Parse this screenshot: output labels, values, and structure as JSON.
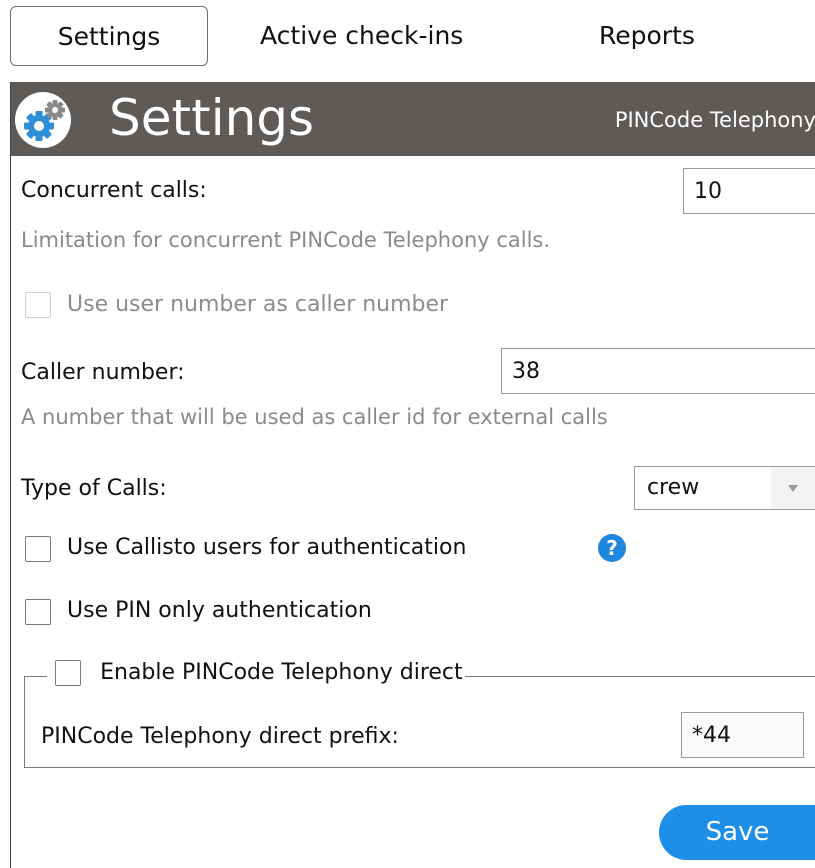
{
  "tabs": [
    {
      "label": "Settings",
      "active": true
    },
    {
      "label": "Active check-ins",
      "active": false
    },
    {
      "label": "Reports",
      "active": false
    }
  ],
  "header": {
    "title": "Settings",
    "subtitle": "PINCode Telephony",
    "logo_icon": "gears-icon",
    "background": "#5d5a58"
  },
  "form": {
    "concurrent_calls": {
      "label": "Concurrent calls:",
      "value": "10",
      "hint": "Limitation for concurrent PINCode Telephony calls."
    },
    "use_user_number": {
      "label": "Use user number as caller number",
      "checked": false,
      "disabled": true
    },
    "caller_number": {
      "label": "Caller number:",
      "value": "38",
      "hint": "A number that will be used as caller id for external calls"
    },
    "type_of_calls": {
      "label": "Type of Calls:",
      "selected": "crew"
    },
    "use_callisto_users": {
      "label": "Use Callisto users for authentication",
      "checked": false,
      "help_icon": "?"
    },
    "use_pin_only": {
      "label": "Use PIN only authentication",
      "checked": false
    },
    "direct": {
      "legend_label": "Enable PINCode Telephony direct",
      "checked": false,
      "prefix_label": "PINCode Telephony direct prefix:",
      "prefix_value": "*44"
    }
  },
  "actions": {
    "save_label": "Save",
    "accent": "#1e8fe8"
  }
}
